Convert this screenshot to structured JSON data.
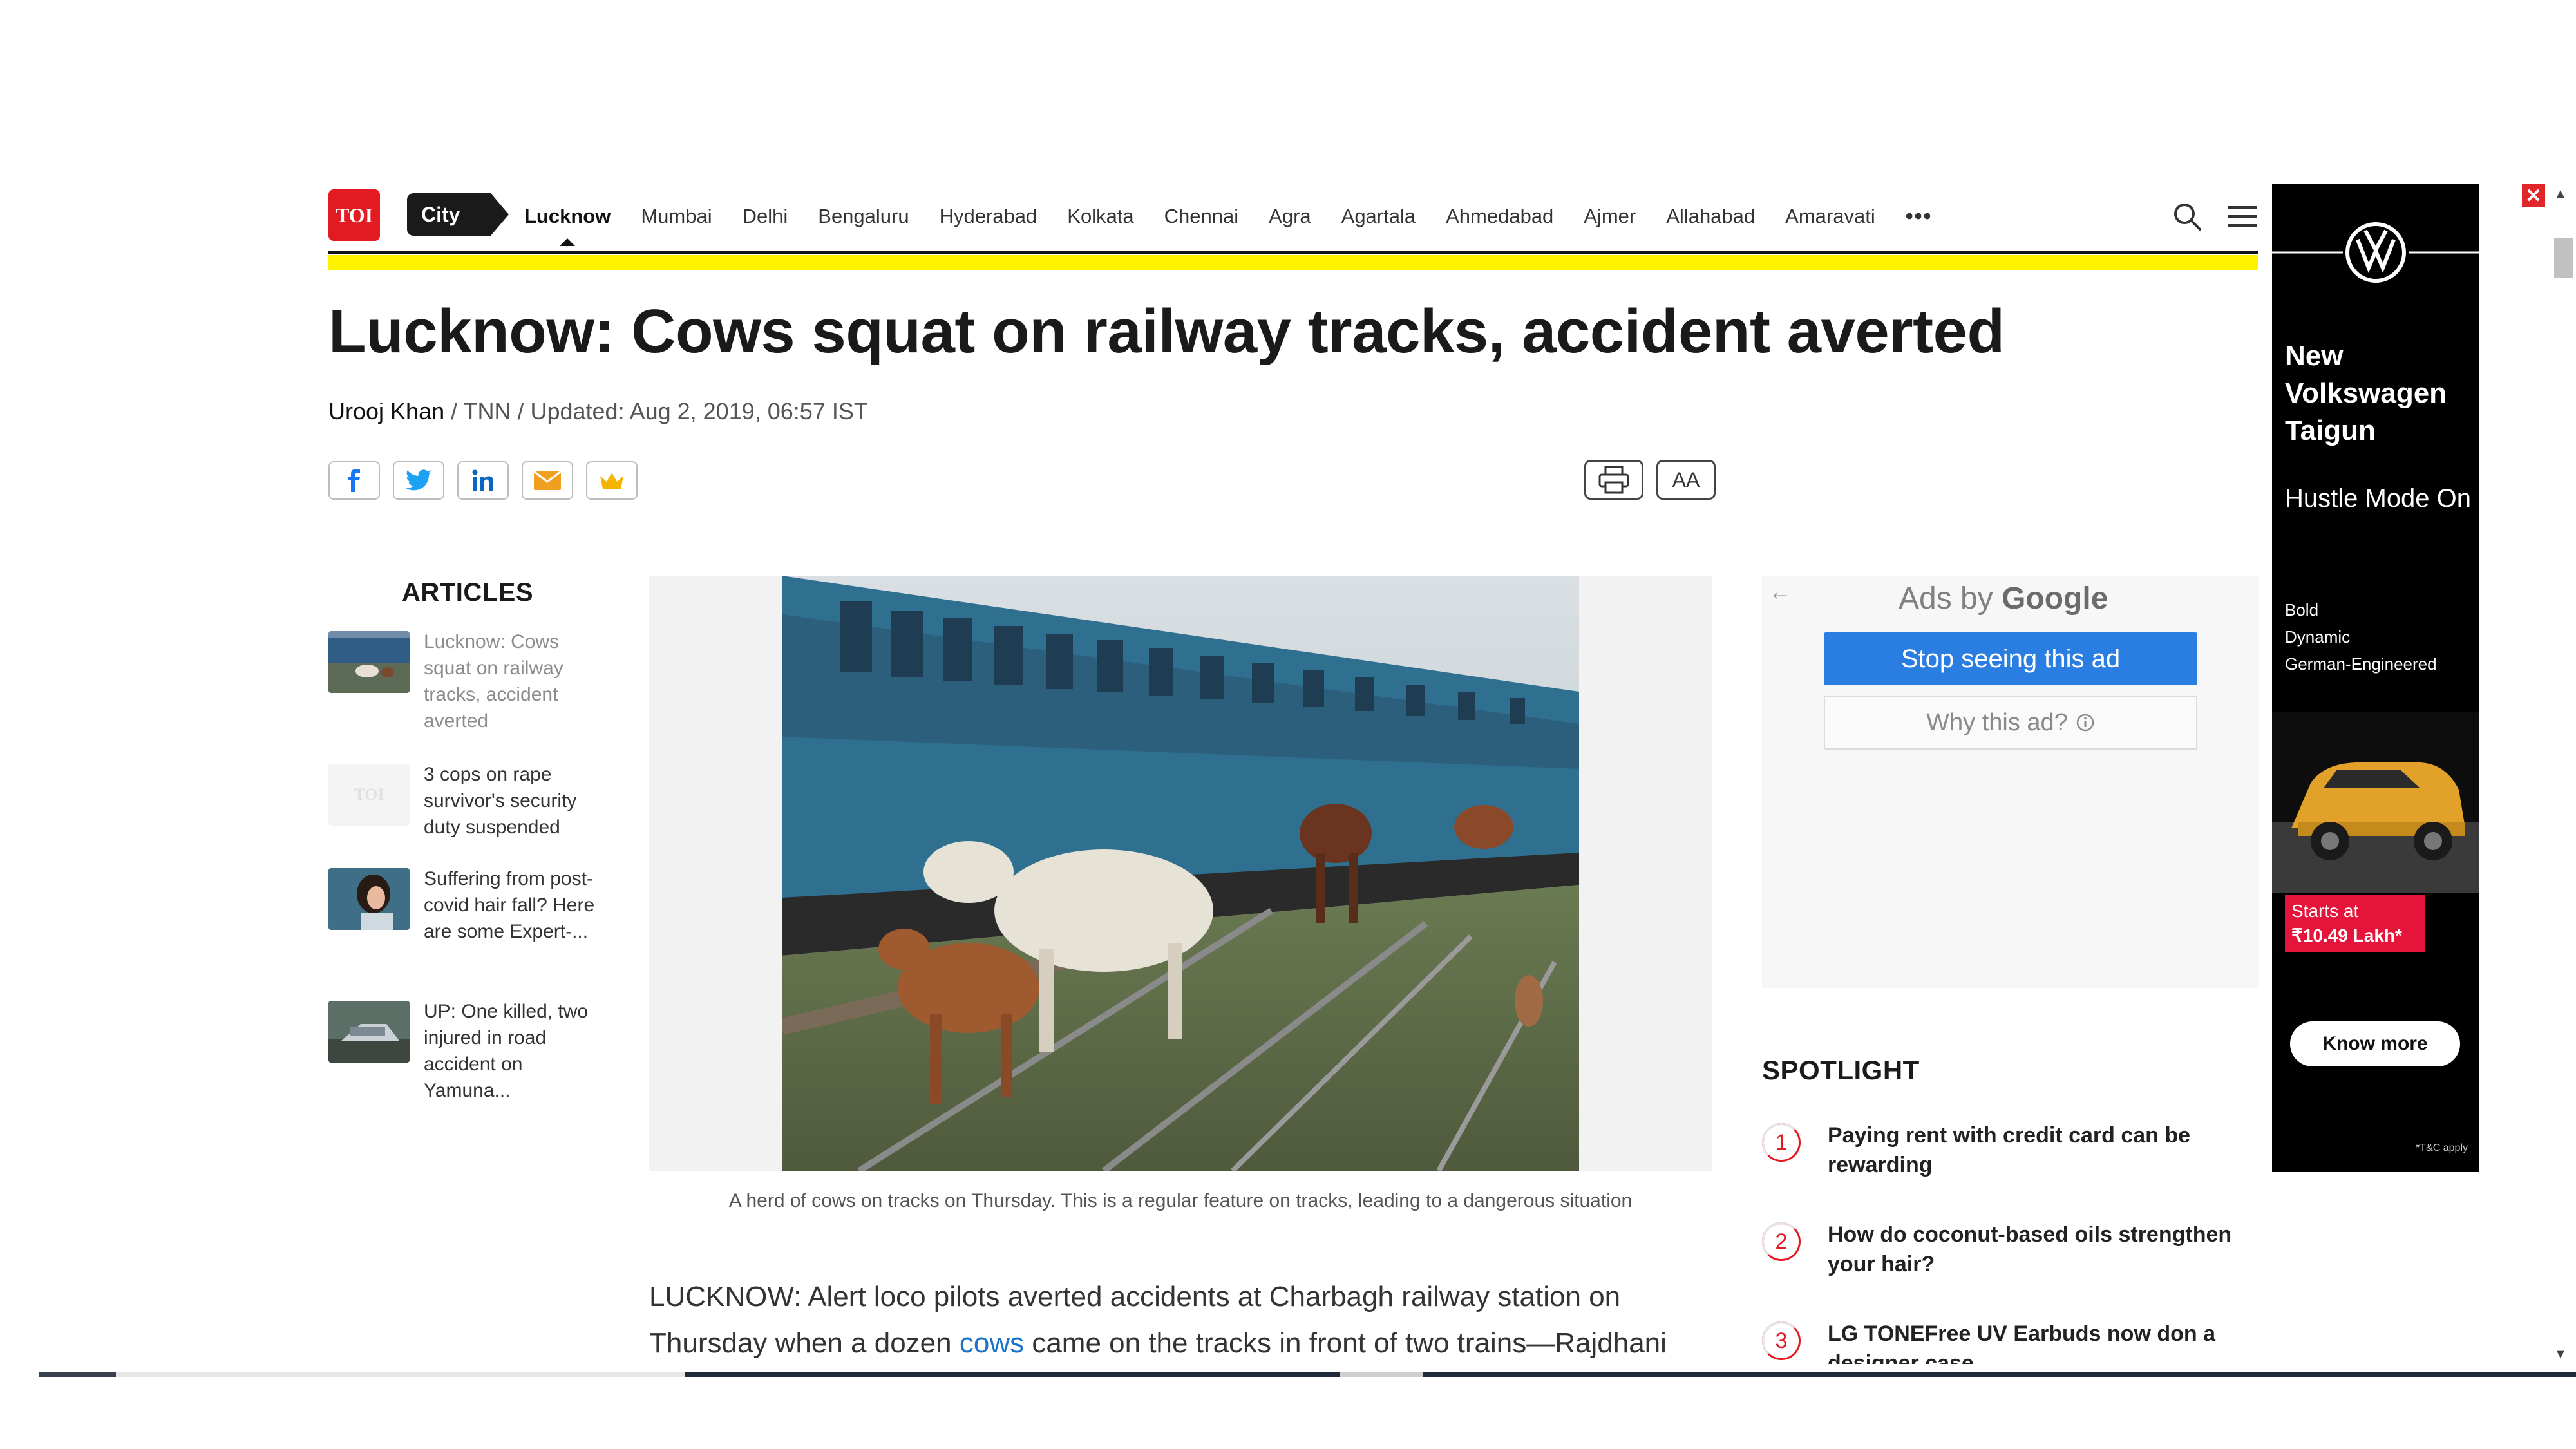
{
  "nav": {
    "logo_text": "TOI",
    "section_tag": "City",
    "cities": [
      "Lucknow",
      "Mumbai",
      "Delhi",
      "Bengaluru",
      "Hyderabad",
      "Kolkata",
      "Chennai",
      "Agra",
      "Agartala",
      "Ahmedabad",
      "Ajmer",
      "Allahabad",
      "Amaravati"
    ],
    "active_city": "Lucknow",
    "more_icon": "more-dots-icon",
    "search_icon": "search-icon",
    "menu_icon": "hamburger-menu-icon",
    "accent_color": "#fff200",
    "brand_color": "#e21b22"
  },
  "article": {
    "headline": "Lucknow: Cows squat on railway tracks, accident averted",
    "author": "Urooj Khan",
    "byline_rest": " / TNN / Updated: Aug 2, 2019, 06:57 IST",
    "image_caption": "A herd of cows on tracks on Thursday. This is a regular feature on tracks, leading to a dangerous situation",
    "body_part1": "LUCKNOW: Alert loco pilots averted accidents at Charbagh railway station on Thursday when a dozen ",
    "body_link": "cows",
    "body_part2": " came on the tracks in front of two trains—Rajdhani"
  },
  "share": {
    "icons": [
      "facebook-icon",
      "twitter-icon",
      "linkedin-icon",
      "mail-icon",
      "crown-icon"
    ],
    "print_icon": "print-icon",
    "font_size_label": "AA"
  },
  "articles_sidebar": {
    "title": "ARTICLES",
    "items": [
      {
        "text": "Lucknow: Cows squat on railway tracks, accident averted"
      },
      {
        "text": "3 cops on rape survivor's security duty suspended",
        "thumb_text": "TOI"
      },
      {
        "text": "Suffering from post-covid hair fall? Here are some Expert-..."
      },
      {
        "text": "UP: One killed, two injured in road accident on Yamuna..."
      }
    ]
  },
  "google_ads": {
    "label_prefix": "Ads by ",
    "label_brand": "Google",
    "stop_label": "Stop seeing this ad",
    "why_label": "Why this ad?",
    "back_icon": "back-arrow-icon",
    "info_icon": "info-icon"
  },
  "spotlight": {
    "title": "SPOTLIGHT",
    "items": [
      {
        "num": "1",
        "text": "Paying rent with credit card can be rewarding"
      },
      {
        "num": "2",
        "text": "How do coconut-based oils strengthen your hair?"
      },
      {
        "num": "3",
        "text": "LG TONEFree UV Earbuds now don a designer case"
      }
    ]
  },
  "vw_ad": {
    "logo_icon": "volkswagen-logo-icon",
    "title": "New Volkswagen Taigun",
    "subtitle": "Hustle Mode On",
    "tagline_1": "Bold",
    "tagline_2": "Dynamic",
    "tagline_3": "German-Engineered",
    "price_line1": "Starts at",
    "price_line2": "₹10.49 Lakh*",
    "cta": "Know more",
    "tc": "*T&C apply",
    "close_icon": "close-icon"
  }
}
